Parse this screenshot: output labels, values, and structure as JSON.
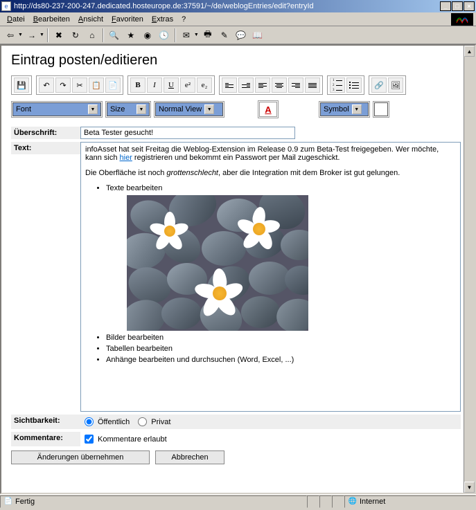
{
  "window": {
    "url": "http://ds80-237-200-247.dedicated.hosteurope.de:37591/~/de/weblogEntries/edit?entryId",
    "minimize": "_",
    "maximize": "□",
    "close": "×"
  },
  "menubar": {
    "datei_pre": "",
    "datei_hot": "D",
    "datei_post": "atei",
    "bearbeiten_pre": "",
    "bearbeiten_hot": "B",
    "bearbeiten_post": "earbeiten",
    "ansicht_pre": "",
    "ansicht_hot": "A",
    "ansicht_post": "nsicht",
    "favoriten_pre": "",
    "favoriten_hot": "F",
    "favoriten_post": "avoriten",
    "extras_pre": "",
    "extras_hot": "E",
    "extras_post": "xtras",
    "help": "?"
  },
  "page": {
    "title": "Eintrag posten/editieren"
  },
  "editor_toolbar": {
    "bold": "B",
    "italic": "I",
    "underline": "U",
    "sup": "e²",
    "sub": "e₂",
    "save": "💾",
    "undo": "↶",
    "redo": "↷",
    "cut": "✂",
    "copy": "📋",
    "paste": "📄",
    "outdent": "⇤",
    "indent": "⇥"
  },
  "dropdowns": {
    "font": "Font",
    "size": "Size",
    "view": "Normal View",
    "symbol": "Symbol",
    "color": "A"
  },
  "form": {
    "heading_label": "Überschrift:",
    "heading_value": "Beta Tester gesucht!",
    "text_label": "Text:",
    "body": {
      "p1a": "infoAsset hat seit Freitag die Weblog-Extension im Release 0.9 zum Beta-Test freigegeben. Wer möchte, kann sich ",
      "p1_link": "hier",
      "p1b": " registrieren und bekommt ein Passwort per Mail zugeschickt.",
      "p2a": "Die Oberfläche ist noch ",
      "p2_em": "grottenschlecht",
      "p2b": ", aber die Integration mit dem Broker ist gut gelungen.",
      "li1": "Texte bearbeiten",
      "li2": "Bilder bearbeiten",
      "li3": "Tabellen bearbeiten",
      "li4": "Anhänge bearbeiten und durchsuchen (Word, Excel, ...)"
    },
    "visibility_label": "Sichtbarkeit:",
    "visibility_public": "Öffentlich",
    "visibility_private": "Privat",
    "comments_label": "Kommentare:",
    "comments_allowed": "Kommentare erlaubt",
    "save_btn": "Änderungen übernehmen",
    "cancel_btn": "Abbrechen"
  },
  "status": {
    "ready": "Fertig",
    "zone": "Internet"
  }
}
